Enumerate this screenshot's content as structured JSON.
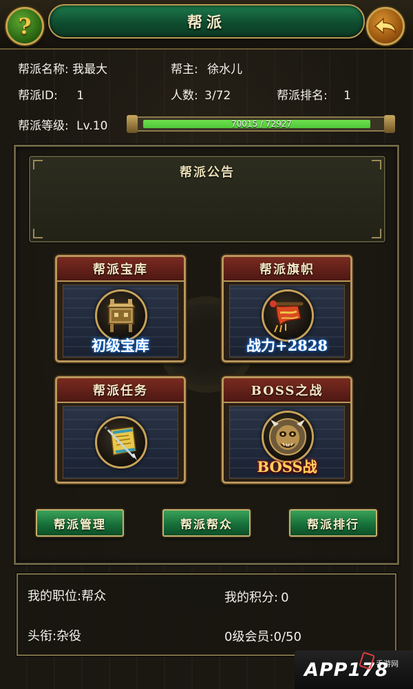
{
  "header": {
    "title": "帮派"
  },
  "info": {
    "name_label": "帮派名称:",
    "name_value": "我最大",
    "leader_label": "帮主:",
    "leader_value": "徐水儿",
    "id_label": "帮派ID:",
    "id_value": "1",
    "members_label": "人数:",
    "members_value": "3/72",
    "rank_label": "帮派排名:",
    "rank_value": "1",
    "level_label": "帮派等级:",
    "level_value": "Lv.10",
    "exp_text": "70015 / 72927",
    "exp_fraction": 0.96
  },
  "announcement": {
    "title": "帮派公告"
  },
  "cards": {
    "treasury": {
      "title": "帮派宝库",
      "caption": "初级宝库",
      "icon": "treasure-cauldron-icon"
    },
    "banner": {
      "title": "帮派旗帜",
      "caption": "战力+2828",
      "icon": "flag-banner-icon"
    },
    "tasks": {
      "title": "帮派任务",
      "icon": "scroll-sword-icon"
    },
    "boss": {
      "title": "BOSS之战",
      "caption": "BOSS战",
      "icon": "demon-mask-icon"
    }
  },
  "actions": {
    "manage": "帮派管理",
    "members": "帮派帮众",
    "ranking": "帮派排行"
  },
  "me": {
    "position_label": "我的职位:",
    "position_value": "帮众",
    "points_label": "我的积分:",
    "points_value": "0",
    "title_label": "头衔:",
    "title_value": "杂役",
    "vip_label": "0级会员:",
    "vip_value": "0/50"
  },
  "watermark": {
    "text": "APP178",
    "sub": "手游网"
  },
  "colors": {
    "accent_green": "#1c7a4c",
    "gold_border": "#b8975a",
    "card_head_red": "#7a2a20",
    "exp_green": "#4fc83a"
  }
}
